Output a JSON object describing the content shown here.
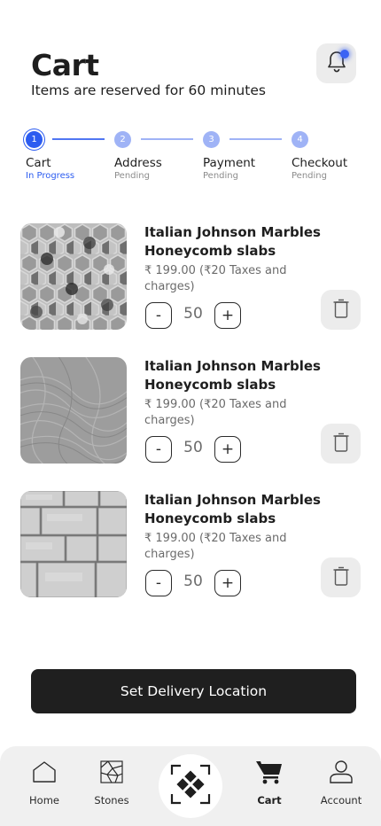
{
  "header": {
    "title": "Cart",
    "subtitle": "Items are reserved for 60 minutes"
  },
  "notification": {
    "icon": "bell-icon",
    "has_unread": true,
    "dot_color": "#3b63f4"
  },
  "stepper": {
    "steps": [
      {
        "number": "1",
        "label": "Cart",
        "status": "In Progress",
        "active": true
      },
      {
        "number": "2",
        "label": "Address",
        "status": "Pending",
        "active": false
      },
      {
        "number": "3",
        "label": "Payment",
        "status": "Pending",
        "active": false
      },
      {
        "number": "4",
        "label": "Checkout",
        "status": "Pending",
        "active": false
      }
    ],
    "active_color": "#2c5cf0",
    "pending_color": "#9fb3f6"
  },
  "cart": {
    "items": [
      {
        "name": "Italian Johnson Marbles Honeycomb slabs",
        "price": "₹ 199.00 (₹20 Taxes and charges)",
        "minus": "-",
        "plus": "+",
        "quantity": "50",
        "image": "hexagon-marble-tile"
      },
      {
        "name": "Italian Johnson Marbles Honeycomb slabs",
        "price": "₹ 199.00 (₹20 Taxes and charges)",
        "minus": "-",
        "plus": "+",
        "quantity": "50",
        "image": "grey-plaster-texture"
      },
      {
        "name": "Italian Johnson Marbles Honeycomb slabs",
        "price": "₹ 199.00 (₹20 Taxes and charges)",
        "minus": "-",
        "plus": "+",
        "quantity": "50",
        "image": "white-stone-brick-wall"
      }
    ]
  },
  "cta": {
    "label": "Set Delivery Location"
  },
  "tabbar": {
    "tabs": [
      {
        "label": "Home",
        "icon": "home-icon",
        "active": false
      },
      {
        "label": "Stones",
        "icon": "stones-icon",
        "active": false
      },
      {
        "label": "",
        "icon": "scan-icon",
        "active": false
      },
      {
        "label": "Cart",
        "icon": "cart-icon",
        "active": true
      },
      {
        "label": "Account",
        "icon": "account-icon",
        "active": false
      }
    ]
  }
}
